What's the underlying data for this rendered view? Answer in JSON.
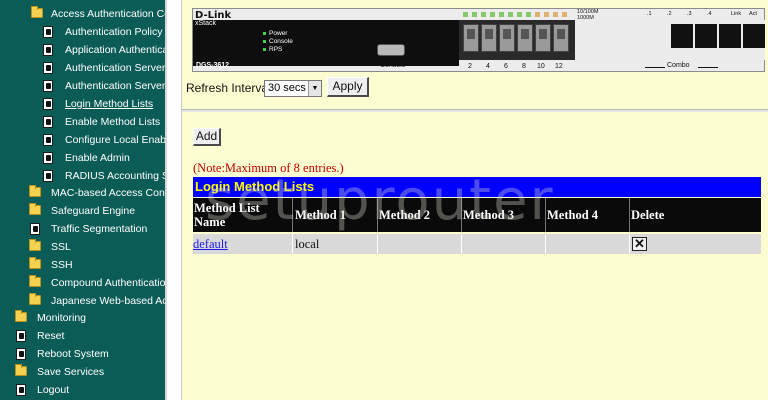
{
  "nav": {
    "items": [
      {
        "label": "Access Authentication Co",
        "icon": "folder-icon",
        "level": 1
      },
      {
        "label": "Authentication Policy a",
        "icon": "document-icon",
        "level": 2
      },
      {
        "label": "Application Authenticat",
        "icon": "document-icon",
        "level": 2
      },
      {
        "label": "Authentication Server G",
        "icon": "document-icon",
        "level": 2
      },
      {
        "label": "Authentication Server H",
        "icon": "document-icon",
        "level": 2
      },
      {
        "label": "Login Method Lists",
        "icon": "document-icon",
        "level": 2,
        "selected": true
      },
      {
        "label": "Enable Method Lists",
        "icon": "document-icon",
        "level": 2
      },
      {
        "label": "Configure Local Enabl",
        "icon": "document-icon",
        "level": 2
      },
      {
        "label": "Enable Admin",
        "icon": "document-icon",
        "level": 2
      },
      {
        "label": "RADIUS Accounting Se",
        "icon": "document-icon",
        "level": 2
      },
      {
        "label": "MAC-based Access Contr",
        "icon": "folder-icon",
        "level": 1
      },
      {
        "label": "Safeguard Engine",
        "icon": "folder-icon",
        "level": 1
      },
      {
        "label": "Traffic Segmentation",
        "icon": "document-icon",
        "level": 1
      },
      {
        "label": "SSL",
        "icon": "folder-icon",
        "level": 1
      },
      {
        "label": "SSH",
        "icon": "folder-icon",
        "level": 1
      },
      {
        "label": "Compound Authentication",
        "icon": "folder-icon",
        "level": 1
      },
      {
        "label": "Japanese Web-based Ac",
        "icon": "folder-icon",
        "level": 1
      },
      {
        "label": "Monitoring",
        "icon": "folder-icon",
        "level": 0
      },
      {
        "label": "Reset",
        "icon": "document-icon",
        "level": 0
      },
      {
        "label": "Reboot System",
        "icon": "document-icon",
        "level": 0
      },
      {
        "label": "Save Services",
        "icon": "folder-icon",
        "level": 0
      },
      {
        "label": "Logout",
        "icon": "document-icon",
        "level": 0
      }
    ]
  },
  "device": {
    "brand": "D-Link",
    "series": "xStack",
    "model": "DGS-3612",
    "leds": [
      "Power",
      "Console",
      "RPS"
    ],
    "console_label": "Console",
    "ports": [
      "2",
      "4",
      "6",
      "8",
      "10",
      "12"
    ],
    "combo_label": "Combo",
    "speed_labels": [
      "10/100M",
      "1000M"
    ],
    "top_labels": [
      ".1",
      ".2",
      ".3",
      ".4",
      "Link",
      "Act"
    ]
  },
  "refresh": {
    "label": "Refresh Interval:",
    "value": "30 secs",
    "apply_label": "Apply"
  },
  "add_label": "Add",
  "note": "(Note:Maximum of 8 entries.)",
  "table": {
    "title": "Login Method Lists",
    "headers": [
      "Method List Name",
      "Method 1",
      "Method 2",
      "Method 3",
      "Method 4",
      "Delete"
    ],
    "rows": [
      {
        "name": "default",
        "method1": "local",
        "method2": "",
        "method3": "",
        "method4": ""
      }
    ]
  },
  "watermark": "setuprouter",
  "colors": {
    "nav_bg": "#0b5c57",
    "page_bg": "#fdfdd2",
    "title_bar": "#0000ff",
    "title_text": "#ffff00",
    "note_text": "#c00000"
  }
}
